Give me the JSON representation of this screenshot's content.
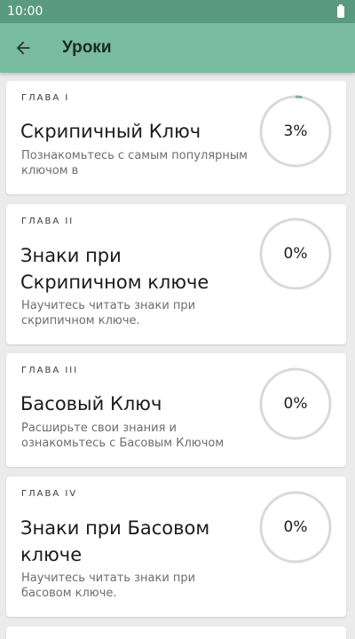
{
  "status_bar": {
    "time": "10:00"
  },
  "app_bar": {
    "title": "Уроки",
    "back_icon": "arrow-back-icon"
  },
  "colors": {
    "status_bar": "#5a9a80",
    "app_bar": "#79bca1",
    "progress_accent": "#6fb79a",
    "progress_track": "#d9d9d9"
  },
  "lessons": [
    {
      "chapter": "ГЛАВА I",
      "title": "Скрипичный Ключ",
      "description": "Познакомьтесь с самым популярным ключом в",
      "progress_label": "3%",
      "progress": 0.03
    },
    {
      "chapter": "ГЛАВА II",
      "title": "Знаки при Скрипичном ключе",
      "description": "Научитесь читать знаки при скрипичном ключе.",
      "progress_label": "0%",
      "progress": 0
    },
    {
      "chapter": "ГЛАВА III",
      "title": "Басовый Ключ",
      "description": "Расширьте свои знания и ознакомьтесь с Басовым Ключом",
      "progress_label": "0%",
      "progress": 0
    },
    {
      "chapter": "ГЛАВА IV",
      "title": "Знаки при Басовом ключе",
      "description": "Научитесь читать знаки при басовом ключе.",
      "progress_label": "0%",
      "progress": 0
    }
  ]
}
